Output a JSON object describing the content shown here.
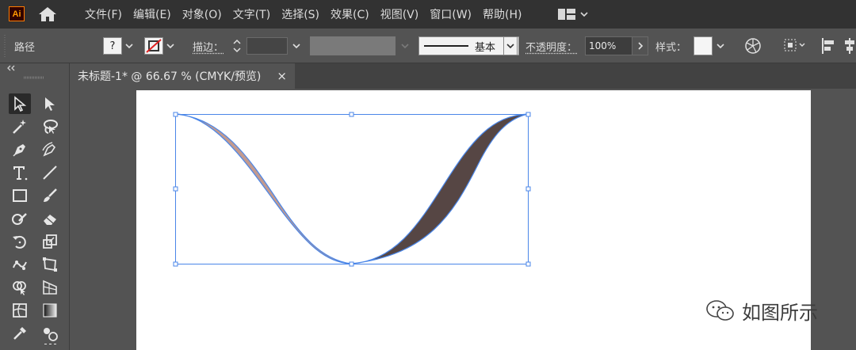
{
  "app": {
    "logo_text": "Ai",
    "menu": [
      "文件(F)",
      "编辑(E)",
      "对象(O)",
      "文字(T)",
      "选择(S)",
      "效果(C)",
      "视图(V)",
      "窗口(W)",
      "帮助(H)"
    ]
  },
  "control_bar": {
    "selection_type": "路径",
    "fill_value": "?",
    "stroke_label": "描边：",
    "brush_style": "基本",
    "opacity_label": "不透明度：",
    "opacity_value": "100%",
    "style_label": "样式："
  },
  "document": {
    "tab_title": "未标题-1* @ 66.67 % (CMYK/预览)",
    "close_glyph": "×"
  },
  "artwork": {
    "left_ribbon_color": "#c29a8f",
    "right_ribbon_color": "#564644",
    "selection_color": "#4a86e8"
  },
  "watermark": {
    "text": "如图所示",
    "icon": "wechat-icon"
  }
}
